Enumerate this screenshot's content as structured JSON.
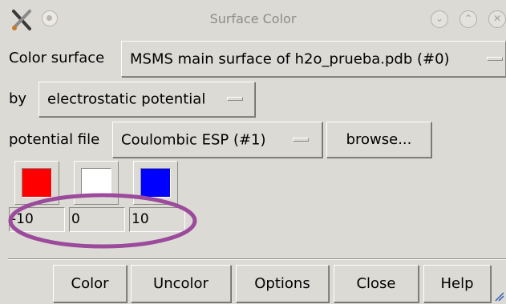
{
  "window": {
    "title": "Surface Color",
    "app_icon": "scissors-x-icon",
    "controls": [
      "minimize-icon",
      "maximize-icon",
      "close-icon"
    ]
  },
  "surface_row": {
    "label": "Color surface",
    "value": "MSMS main surface of h2o_prueba.pdb (#0)"
  },
  "by_row": {
    "label": "by",
    "value": "electrostatic potential"
  },
  "potential_row": {
    "label": "potential file",
    "value": "Coulombic ESP (#1)",
    "browse_label": "browse..."
  },
  "color_stops": [
    {
      "color": "#ff0000",
      "value": "-10"
    },
    {
      "color": "#ffffff",
      "value": "0"
    },
    {
      "color": "#0000ff",
      "value": "10"
    }
  ],
  "annotation": {
    "color": "#9b4a9c"
  },
  "buttons": {
    "color": "Color",
    "uncolor": "Uncolor",
    "options": "Options",
    "close": "Close",
    "help": "Help"
  }
}
